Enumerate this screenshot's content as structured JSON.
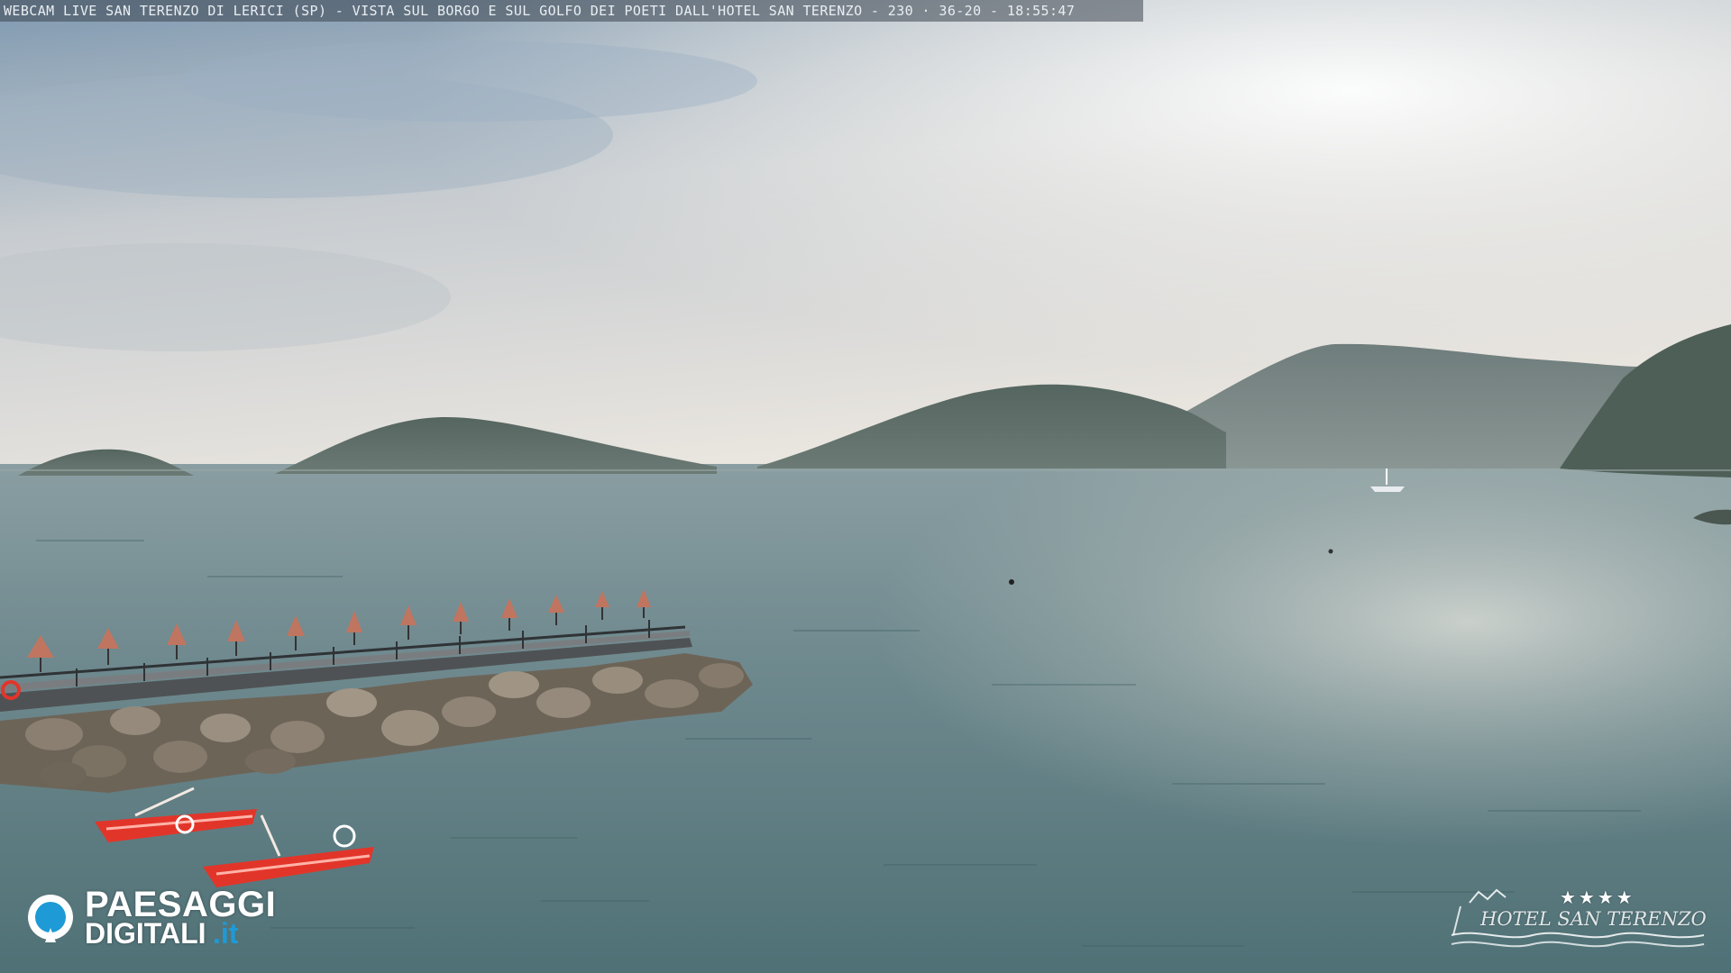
{
  "overlay": {
    "title": "WEBCAM LIVE SAN TERENZO DI LERICI (SP) - VISTA SUL BORGO E SUL GOLFO DEI POETI DALL'HOTEL SAN TERENZO - 230 · 36-20 - 18:55:47"
  },
  "logo_left": {
    "word1": "PAESAGGI",
    "word2": "DIGITALI",
    "word3": ".it",
    "icon": "camera-lens-icon",
    "accent": "#1e9ad6"
  },
  "logo_right": {
    "stars": "★★★★",
    "name": "HOTEL SAN TERENZO",
    "icon": "hotel-waves-icon"
  },
  "scene": {
    "sky_top": "#8fa6b8",
    "sky_bottom": "#e6e4df",
    "sea": "#5f7d82",
    "boat_color": "#e2352a"
  }
}
